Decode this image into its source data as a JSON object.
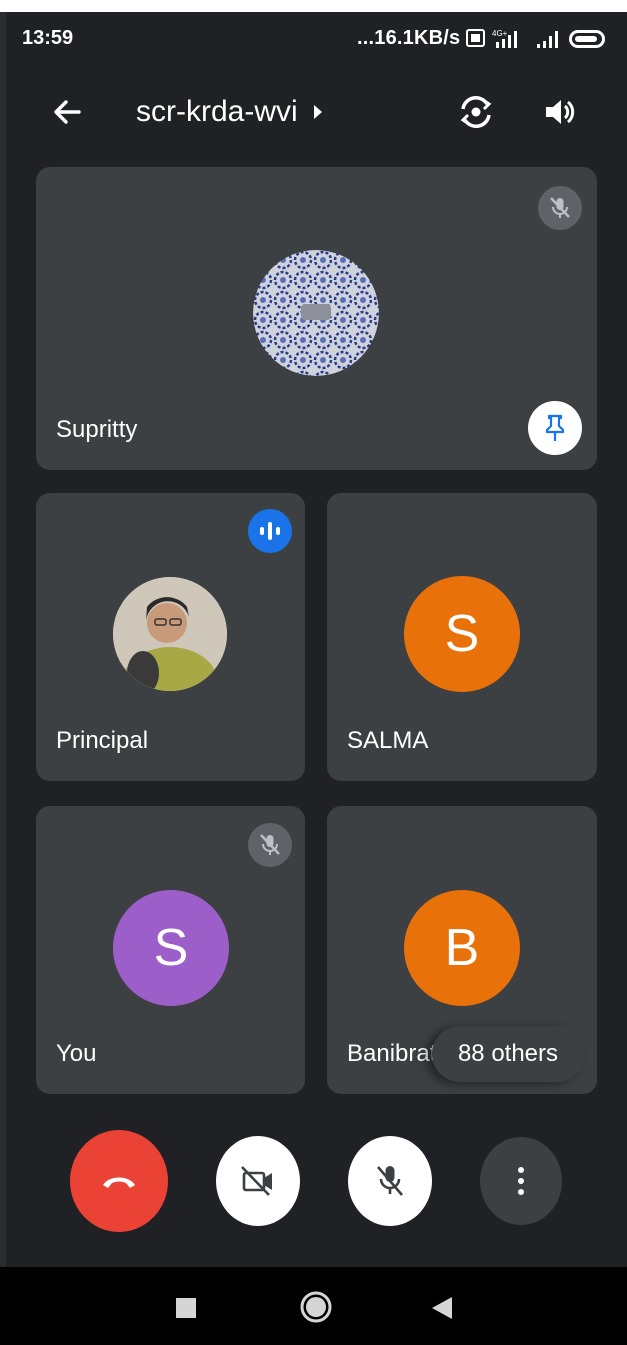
{
  "status_bar": {
    "time": "13:59",
    "network_speed": "...16.1KB/s",
    "icons": [
      "volte-icon",
      "signal-4g-icon",
      "signal-icon",
      "battery-icon"
    ]
  },
  "header": {
    "meeting_code": "scr-krda-wvi",
    "icons": [
      "back-arrow-icon",
      "chevron-right-icon",
      "switch-camera-icon",
      "speaker-icon"
    ]
  },
  "tiles": [
    {
      "name": "Supritty",
      "avatar": "image",
      "mic": "muted",
      "pinned": true
    },
    {
      "name": "Principal",
      "avatar": "photo",
      "speaking": true
    },
    {
      "name": "SALMA",
      "avatar_letter": "S",
      "avatar_color": "#e8710a"
    },
    {
      "name": "You",
      "avatar_letter": "S",
      "avatar_color": "#9c5fc9",
      "mic": "muted"
    },
    {
      "name": "Banibrat",
      "avatar_letter": "B",
      "avatar_color": "#e8710a"
    }
  ],
  "others_chip": "88 others",
  "controls": [
    "end-call",
    "camera-off",
    "mic-off",
    "more-options"
  ],
  "colors": {
    "background": "#202124",
    "tile": "#3c4043",
    "end_call": "#ea4335",
    "speaking": "#1a73e8",
    "avatar_orange": "#e8710a",
    "avatar_purple": "#9c5fc9"
  }
}
